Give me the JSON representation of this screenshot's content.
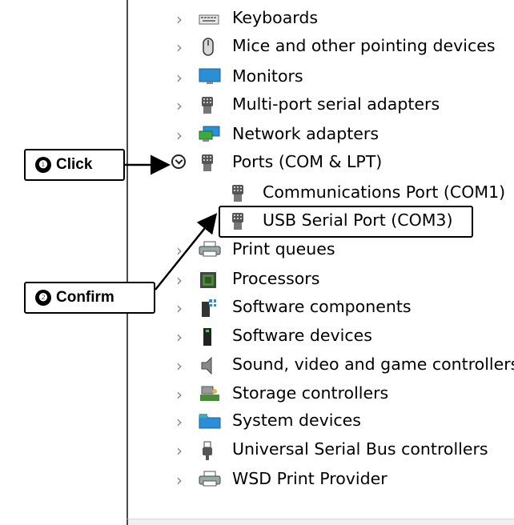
{
  "device_tree": {
    "items": [
      {
        "label": "Keyboards",
        "icon": "keyboard-icon",
        "state": "collapsed"
      },
      {
        "label": "Mice and other pointing devices",
        "icon": "mouse-icon",
        "state": "collapsed"
      },
      {
        "label": "Monitors",
        "icon": "monitor-icon",
        "state": "collapsed"
      },
      {
        "label": "Multi-port serial adapters",
        "icon": "serial-port-icon",
        "state": "collapsed"
      },
      {
        "label": "Network adapters",
        "icon": "network-adapter-icon",
        "state": "collapsed"
      },
      {
        "label": "Ports (COM & LPT)",
        "icon": "serial-port-icon",
        "state": "expanded"
      },
      {
        "label": "Communications Port (COM1)",
        "icon": "serial-port-icon",
        "state": "child"
      },
      {
        "label": "USB Serial Port (COM3)",
        "icon": "serial-port-icon",
        "state": "child"
      },
      {
        "label": "Print queues",
        "icon": "printer-icon",
        "state": "collapsed"
      },
      {
        "label": "Processors",
        "icon": "processor-icon",
        "state": "collapsed"
      },
      {
        "label": "Software components",
        "icon": "software-component-icon",
        "state": "collapsed"
      },
      {
        "label": "Software devices",
        "icon": "software-device-icon",
        "state": "collapsed"
      },
      {
        "label": "Sound, video and game controllers",
        "icon": "speaker-icon",
        "state": "collapsed"
      },
      {
        "label": "Storage controllers",
        "icon": "storage-controller-icon",
        "state": "collapsed"
      },
      {
        "label": "System devices",
        "icon": "folder-icon",
        "state": "collapsed"
      },
      {
        "label": "Universal Serial Bus controllers",
        "icon": "usb-icon",
        "state": "collapsed"
      },
      {
        "label": "WSD Print Provider",
        "icon": "printer-icon",
        "state": "collapsed"
      }
    ]
  },
  "annotations": {
    "step1": {
      "number": "❶",
      "label": "Click"
    },
    "step2": {
      "number": "❷",
      "label": "Confirm"
    }
  },
  "colors": {
    "border": "#000000",
    "chevron": "#8a8a8a",
    "monitor_blue": "#2a8fd6",
    "network_green": "#3caa3c"
  }
}
